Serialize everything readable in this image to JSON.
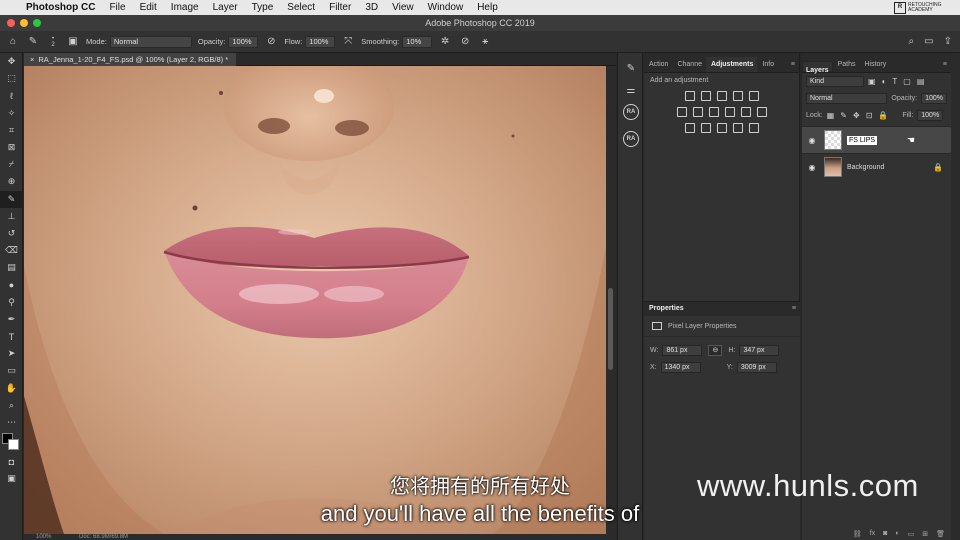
{
  "menubar": {
    "app_name": "Photoshop CC",
    "items": [
      "File",
      "Edit",
      "Image",
      "Layer",
      "Type",
      "Select",
      "Filter",
      "3D",
      "View",
      "Window",
      "Help"
    ],
    "brand_logo_text": "RETOUCHING ACADEMY"
  },
  "window": {
    "title": "Adobe Photoshop CC 2019"
  },
  "options": {
    "brush_size": "2",
    "mode_label": "Mode:",
    "mode_value": "Normal",
    "opacity_label": "Opacity:",
    "opacity_value": "100%",
    "flow_label": "Flow:",
    "flow_value": "100%",
    "smoothing_label": "Smoothing:",
    "smoothing_value": "10%"
  },
  "document": {
    "tab_title": "RA_Jenna_1-20_F4_FS.psd @ 100% (Layer 2, RGB/8) *",
    "close_glyph": "×",
    "zoom": "100%",
    "doc_size": "Doc: 68.9M/69.8M"
  },
  "strip": {
    "badges": [
      "RA",
      "RA"
    ]
  },
  "adjustments": {
    "tabs": [
      "Action",
      "Channe",
      "Adjustments",
      "Info"
    ],
    "selected_tab": "Adjustments",
    "hint": "Add an adjustment",
    "row_counts": [
      5,
      6,
      5
    ]
  },
  "properties": {
    "title": "Properties",
    "kind_label": "Pixel Layer Properties",
    "w_label": "W:",
    "w_value": "861 px",
    "h_label": "H:",
    "h_value": "347 px",
    "x_label": "X:",
    "x_value": "1340 px",
    "y_label": "Y:",
    "y_value": "3009 px",
    "link_glyph": "⊖"
  },
  "layers": {
    "tabs": [
      "Layers",
      "Paths",
      "History"
    ],
    "filter_value": "Kind",
    "blend_mode": "Normal",
    "opacity_label": "Opacity:",
    "opacity_value": "100%",
    "lock_label": "Lock:",
    "fill_label": "Fill:",
    "fill_value": "100%",
    "items": [
      {
        "name": "FS LIPS",
        "editing": true,
        "locked": false
      },
      {
        "name": "Background",
        "editing": false,
        "locked": true
      }
    ],
    "footer_icons": [
      "link-icon",
      "fx-icon",
      "mask-icon",
      "adjustment-icon",
      "folder-icon",
      "new-layer-icon",
      "trash-icon"
    ]
  },
  "watermark": "www.hunls.com",
  "subtitles": {
    "chinese": "您将拥有的所有好处",
    "english": "and you'll have all the benefits of"
  },
  "colors": {
    "panel_bg": "#323232",
    "menubar_bg": "#e8e8e8",
    "skin": "#d9ae8e",
    "lips": "#cf7f8a"
  }
}
